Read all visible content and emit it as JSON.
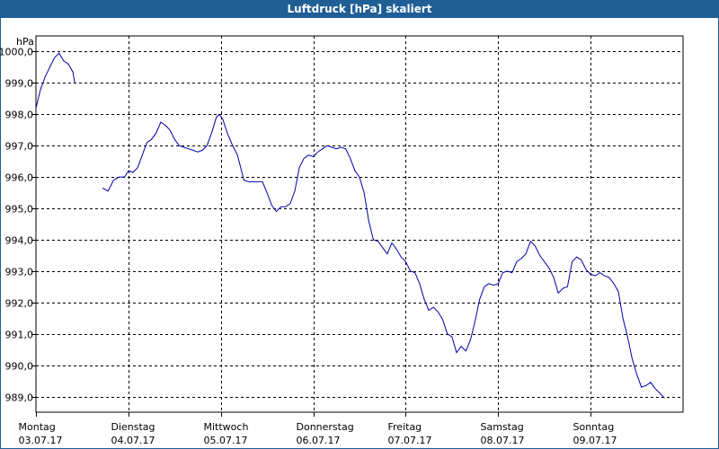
{
  "chart_data": {
    "type": "line",
    "title": "Luftdruck [hPa] skaliert",
    "ylabel": "hPa",
    "xlabel": "",
    "grid": true,
    "ylim": [
      988.5,
      1000.5
    ],
    "xlim": [
      0,
      7
    ],
    "y_ticks": [
      "989,0",
      "990,0",
      "991,0",
      "992,0",
      "993,0",
      "994,0",
      "995,0",
      "996,0",
      "997,0",
      "998,0",
      "999,0",
      "1000,0"
    ],
    "x_ticks": [
      {
        "day": "Montag",
        "date": "03.07.17"
      },
      {
        "day": "Dienstag",
        "date": "04.07.17"
      },
      {
        "day": "Mittwoch",
        "date": "05.07.17"
      },
      {
        "day": "Donnerstag",
        "date": "06.07.17"
      },
      {
        "day": "Freitag",
        "date": "07.07.17"
      },
      {
        "day": "Samstag",
        "date": "08.07.17"
      },
      {
        "day": "Sonntag",
        "date": "09.07.17"
      }
    ],
    "series": [
      {
        "color": "#0000aa",
        "segments": [
          [
            [
              0.0,
              998.2
            ],
            [
              0.05,
              998.8
            ],
            [
              0.1,
              999.2
            ],
            [
              0.15,
              999.5
            ],
            [
              0.2,
              999.8
            ],
            [
              0.25,
              999.95
            ],
            [
              0.3,
              999.7
            ],
            [
              0.35,
              999.6
            ],
            [
              0.4,
              999.35
            ],
            [
              0.42,
              999.0
            ]
          ],
          [
            [
              0.72,
              995.65
            ],
            [
              0.78,
              995.55
            ],
            [
              0.84,
              995.9
            ],
            [
              0.9,
              996.0
            ],
            [
              0.96,
              996.0
            ],
            [
              1.0,
              996.2
            ],
            [
              1.05,
              996.15
            ],
            [
              1.1,
              996.3
            ],
            [
              1.15,
              996.7
            ],
            [
              1.2,
              997.1
            ],
            [
              1.25,
              997.2
            ],
            [
              1.3,
              997.4
            ],
            [
              1.35,
              997.75
            ],
            [
              1.4,
              997.65
            ],
            [
              1.45,
              997.5
            ],
            [
              1.5,
              997.2
            ],
            [
              1.55,
              997.0
            ],
            [
              1.6,
              996.95
            ],
            [
              1.65,
              996.9
            ],
            [
              1.7,
              996.85
            ],
            [
              1.75,
              996.8
            ],
            [
              1.8,
              996.85
            ],
            [
              1.85,
              997.0
            ],
            [
              1.9,
              997.4
            ],
            [
              1.95,
              997.9
            ],
            [
              1.98,
              998.0
            ],
            [
              2.02,
              997.85
            ],
            [
              2.07,
              997.4
            ],
            [
              2.12,
              997.05
            ],
            [
              2.18,
              996.7
            ],
            [
              2.25,
              995.9
            ],
            [
              2.3,
              995.85
            ],
            [
              2.35,
              995.85
            ],
            [
              2.4,
              995.85
            ],
            [
              2.45,
              995.85
            ],
            [
              2.5,
              995.5
            ],
            [
              2.55,
              995.1
            ],
            [
              2.6,
              994.9
            ],
            [
              2.65,
              995.05
            ],
            [
              2.7,
              995.05
            ],
            [
              2.75,
              995.15
            ],
            [
              2.8,
              995.55
            ],
            [
              2.85,
              996.3
            ],
            [
              2.9,
              996.6
            ],
            [
              2.95,
              996.7
            ],
            [
              3.0,
              996.65
            ],
            [
              3.05,
              996.8
            ],
            [
              3.1,
              996.9
            ],
            [
              3.15,
              997.0
            ],
            [
              3.2,
              996.95
            ],
            [
              3.25,
              996.9
            ],
            [
              3.3,
              996.95
            ],
            [
              3.35,
              996.9
            ],
            [
              3.4,
              996.6
            ],
            [
              3.45,
              996.2
            ],
            [
              3.5,
              996.0
            ],
            [
              3.55,
              995.5
            ],
            [
              3.6,
              994.6
            ],
            [
              3.65,
              994.0
            ],
            [
              3.7,
              993.95
            ],
            [
              3.75,
              993.75
            ],
            [
              3.8,
              993.55
            ],
            [
              3.85,
              993.9
            ],
            [
              3.9,
              993.7
            ],
            [
              3.95,
              993.45
            ],
            [
              4.0,
              993.3
            ],
            [
              4.05,
              993.0
            ],
            [
              4.1,
              992.95
            ],
            [
              4.15,
              992.6
            ],
            [
              4.2,
              992.1
            ],
            [
              4.25,
              991.75
            ],
            [
              4.3,
              991.85
            ],
            [
              4.35,
              991.7
            ],
            [
              4.4,
              991.45
            ],
            [
              4.45,
              991.0
            ],
            [
              4.5,
              990.9
            ],
            [
              4.55,
              990.4
            ],
            [
              4.6,
              990.6
            ],
            [
              4.65,
              990.45
            ],
            [
              4.7,
              990.8
            ],
            [
              4.75,
              991.4
            ],
            [
              4.8,
              992.1
            ],
            [
              4.85,
              992.5
            ],
            [
              4.9,
              992.6
            ],
            [
              4.95,
              992.55
            ],
            [
              5.0,
              992.6
            ],
            [
              5.05,
              992.95
            ],
            [
              5.1,
              993.0
            ],
            [
              5.15,
              992.95
            ],
            [
              5.2,
              993.3
            ],
            [
              5.25,
              993.4
            ],
            [
              5.3,
              993.55
            ],
            [
              5.35,
              993.95
            ],
            [
              5.4,
              993.8
            ],
            [
              5.45,
              993.5
            ],
            [
              5.5,
              993.3
            ],
            [
              5.55,
              993.1
            ],
            [
              5.6,
              992.8
            ],
            [
              5.65,
              992.3
            ],
            [
              5.7,
              992.45
            ],
            [
              5.75,
              992.5
            ],
            [
              5.8,
              993.3
            ],
            [
              5.85,
              993.45
            ],
            [
              5.9,
              993.35
            ],
            [
              5.95,
              993.05
            ],
            [
              6.0,
              992.9
            ],
            [
              6.05,
              992.85
            ],
            [
              6.1,
              992.95
            ],
            [
              6.15,
              992.85
            ],
            [
              6.2,
              992.8
            ],
            [
              6.25,
              992.6
            ],
            [
              6.3,
              992.35
            ],
            [
              6.35,
              991.5
            ],
            [
              6.4,
              990.9
            ],
            [
              6.45,
              990.2
            ],
            [
              6.5,
              989.7
            ],
            [
              6.55,
              989.3
            ],
            [
              6.6,
              989.35
            ],
            [
              6.65,
              989.45
            ],
            [
              6.7,
              989.25
            ],
            [
              6.75,
              989.1
            ],
            [
              6.8,
              988.95
            ]
          ]
        ]
      }
    ]
  }
}
